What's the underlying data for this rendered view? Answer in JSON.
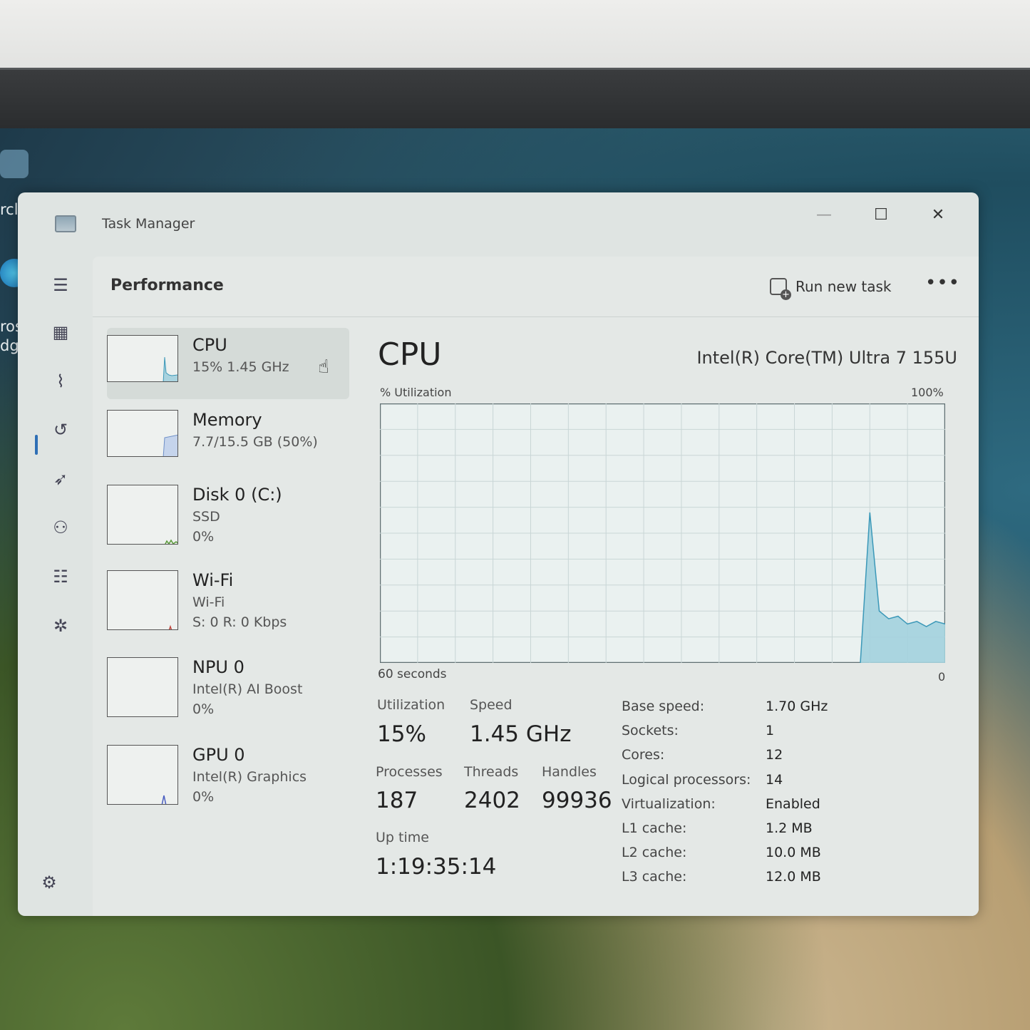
{
  "desktop": {
    "icon_labels": [
      "rcle B",
      "rosof",
      "dge"
    ]
  },
  "window": {
    "title": "Task Manager",
    "minimize": "—",
    "maximize": "☐",
    "close": "✕"
  },
  "nav": {
    "items": [
      {
        "icon": "hamburger-menu-icon",
        "glyph": "☰"
      },
      {
        "icon": "processes-icon",
        "glyph": "▦"
      },
      {
        "icon": "performance-icon",
        "glyph": "⌇"
      },
      {
        "icon": "app-history-icon",
        "glyph": "↺"
      },
      {
        "icon": "startup-apps-icon",
        "glyph": "➶"
      },
      {
        "icon": "users-icon",
        "glyph": "⚇"
      },
      {
        "icon": "details-icon",
        "glyph": "☷"
      },
      {
        "icon": "services-icon",
        "glyph": "✲"
      }
    ],
    "settings_glyph": "⚙"
  },
  "header": {
    "title": "Performance",
    "run_new_task": "Run new task",
    "more": "•••"
  },
  "devices": [
    {
      "name": "CPU",
      "sub": "15%  1.45 GHz",
      "sub2": ""
    },
    {
      "name": "Memory",
      "sub": "7.7/15.5 GB (50%)",
      "sub2": ""
    },
    {
      "name": "Disk 0 (C:)",
      "sub": "SSD",
      "sub2": "0%"
    },
    {
      "name": "Wi-Fi",
      "sub": "Wi-Fi",
      "sub2": "S: 0 R: 0 Kbps"
    },
    {
      "name": "NPU 0",
      "sub": "Intel(R) AI Boost",
      "sub2": "0%"
    },
    {
      "name": "GPU 0",
      "sub": "Intel(R) Graphics",
      "sub2": "0%"
    }
  ],
  "cpu": {
    "title": "CPU",
    "model": "Intel(R) Core(TM) Ultra 7 155U",
    "graph": {
      "ylabel": "% Utilization",
      "ymax_label": "100%",
      "xlabel": "60 seconds",
      "xmin_label": "0"
    },
    "stats": {
      "utilization_label": "Utilization",
      "utilization": "15%",
      "speed_label": "Speed",
      "speed": "1.45 GHz",
      "processes_label": "Processes",
      "processes": "187",
      "threads_label": "Threads",
      "threads": "2402",
      "handles_label": "Handles",
      "handles": "99936",
      "uptime_label": "Up time",
      "uptime": "1:19:35:14"
    },
    "specs": [
      {
        "k": "Base speed:",
        "v": "1.70 GHz"
      },
      {
        "k": "Sockets:",
        "v": "1"
      },
      {
        "k": "Cores:",
        "v": "12"
      },
      {
        "k": "Logical processors:",
        "v": "14"
      },
      {
        "k": "Virtualization:",
        "v": "Enabled"
      },
      {
        "k": "L1 cache:",
        "v": "1.2 MB"
      },
      {
        "k": "L2 cache:",
        "v": "10.0 MB"
      },
      {
        "k": "L3 cache:",
        "v": "12.0 MB"
      }
    ]
  },
  "chart_data": {
    "type": "area",
    "x": [
      60,
      59,
      58,
      57,
      56,
      55,
      54,
      53,
      52,
      51,
      50,
      49,
      48,
      47,
      46,
      45,
      44,
      43,
      42,
      41,
      40,
      39,
      38,
      37,
      36,
      35,
      34,
      33,
      32,
      31,
      30,
      29,
      28,
      27,
      26,
      25,
      24,
      23,
      22,
      21,
      20,
      19,
      18,
      17,
      16,
      15,
      14,
      13,
      12,
      11,
      10,
      9,
      8,
      7,
      6,
      5,
      4,
      3,
      2,
      1,
      0
    ],
    "series": [
      {
        "values": [
          0,
          0,
          0,
          0,
          0,
          0,
          0,
          0,
          0,
          0,
          0,
          0,
          0,
          0,
          0,
          0,
          0,
          0,
          0,
          0,
          0,
          0,
          0,
          0,
          0,
          0,
          0,
          0,
          0,
          0,
          0,
          0,
          0,
          0,
          0,
          0,
          0,
          0,
          0,
          0,
          0,
          0,
          0,
          0,
          0,
          0,
          0,
          0,
          0,
          0,
          0,
          0,
          58,
          20,
          17,
          18,
          15,
          16,
          14,
          16,
          15
        ]
      }
    ],
    "ylim": [
      0,
      100
    ],
    "xlim": [
      60,
      0
    ],
    "grid": true,
    "accent": "#3b98b8"
  }
}
